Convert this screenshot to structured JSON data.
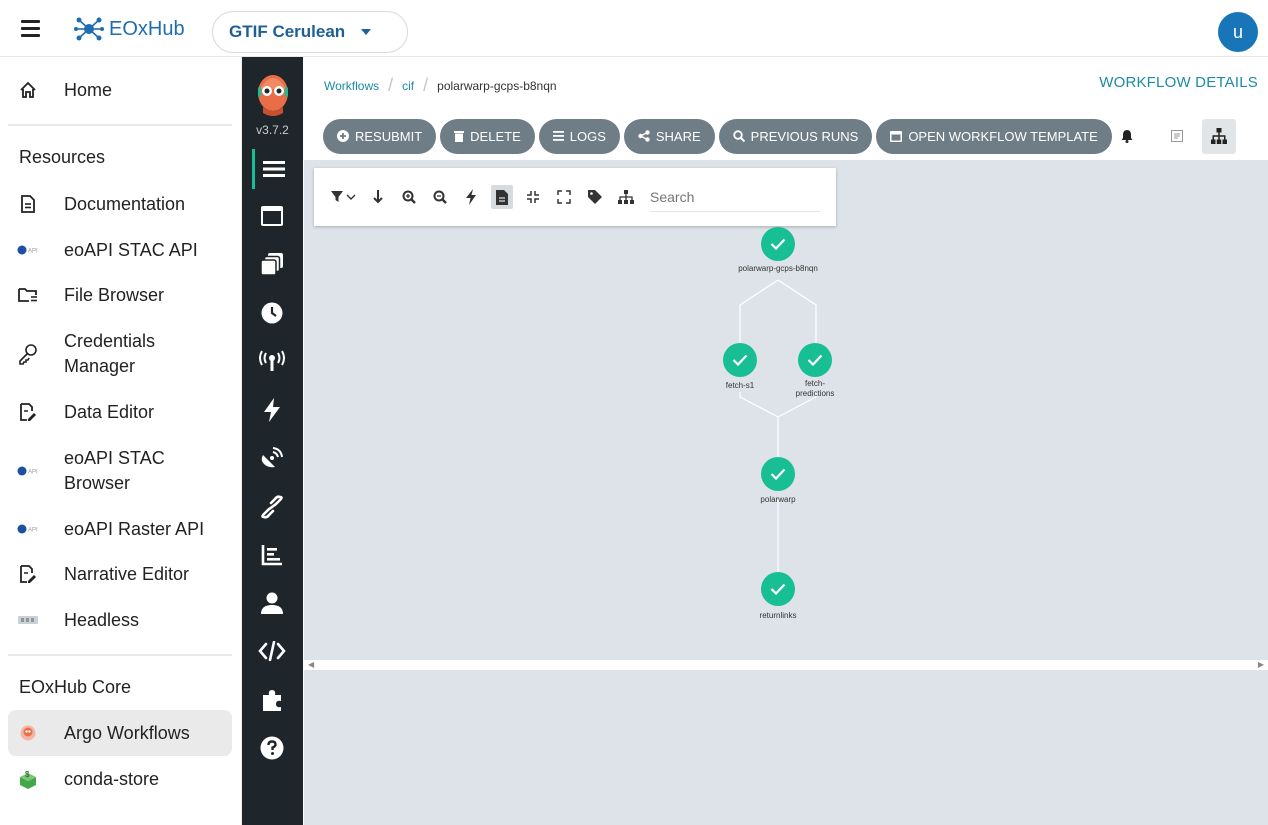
{
  "topbar": {
    "logo_text": "EOxHub",
    "project": "GTIF Cerulean",
    "avatar_initial": "u",
    "brand_color": "#1f6dae"
  },
  "leftnav": {
    "home": "Home",
    "resources_heading": "Resources",
    "resources": [
      {
        "label": "Documentation",
        "icon": "document-icon"
      },
      {
        "label": "eoAPI STAC API",
        "icon": "eoapi-icon"
      },
      {
        "label": "File Browser",
        "icon": "folder-icon"
      },
      {
        "label": "Credentials Manager",
        "icon": "key-icon"
      },
      {
        "label": "Data Editor",
        "icon": "edit-document-icon"
      },
      {
        "label": "eoAPI STAC Browser",
        "icon": "eoapi-icon"
      },
      {
        "label": "eoAPI Raster API",
        "icon": "eoapi-icon"
      },
      {
        "label": "Narrative Editor",
        "icon": "edit-document-icon"
      },
      {
        "label": "Headless",
        "icon": "headless-icon"
      }
    ],
    "core_heading": "EOxHub Core",
    "core": [
      {
        "label": "Argo Workflows",
        "icon": "argo-icon",
        "active": true
      },
      {
        "label": "conda-store",
        "icon": "conda-store-icon"
      }
    ]
  },
  "argo": {
    "version": "v3.7.2",
    "accent": "#18be94",
    "icons": [
      "menu-icon",
      "workflow-templates-icon",
      "cluster-templates-icon",
      "cron-icon",
      "event-sources-icon",
      "sensors-icon",
      "event-flow-icon",
      "link-icon",
      "reports-icon",
      "user-icon",
      "api-docs-icon",
      "plugins-icon",
      "help-icon"
    ]
  },
  "main": {
    "breadcrumb": [
      "Workflows",
      "cif",
      "polarwarp-gcps-b8nqn"
    ],
    "title": "WORKFLOW DETAILS",
    "actions": [
      "RESUBMIT",
      "DELETE",
      "LOGS",
      "SHARE",
      "PREVIOUS RUNS",
      "OPEN WORKFLOW TEMPLATE"
    ],
    "search_placeholder": "Search",
    "nodes": [
      {
        "id": "root",
        "label": "polarwarp-gcps-b8nqn",
        "status": "succeeded"
      },
      {
        "id": "fetch-s1",
        "label": "fetch-s1",
        "status": "succeeded"
      },
      {
        "id": "fetch-predictions",
        "label": "fetch-predictions",
        "status": "succeeded"
      },
      {
        "id": "polarwarp",
        "label": "polarwarp",
        "status": "succeeded"
      },
      {
        "id": "returnlinks",
        "label": "returnlinks",
        "status": "succeeded"
      }
    ]
  }
}
